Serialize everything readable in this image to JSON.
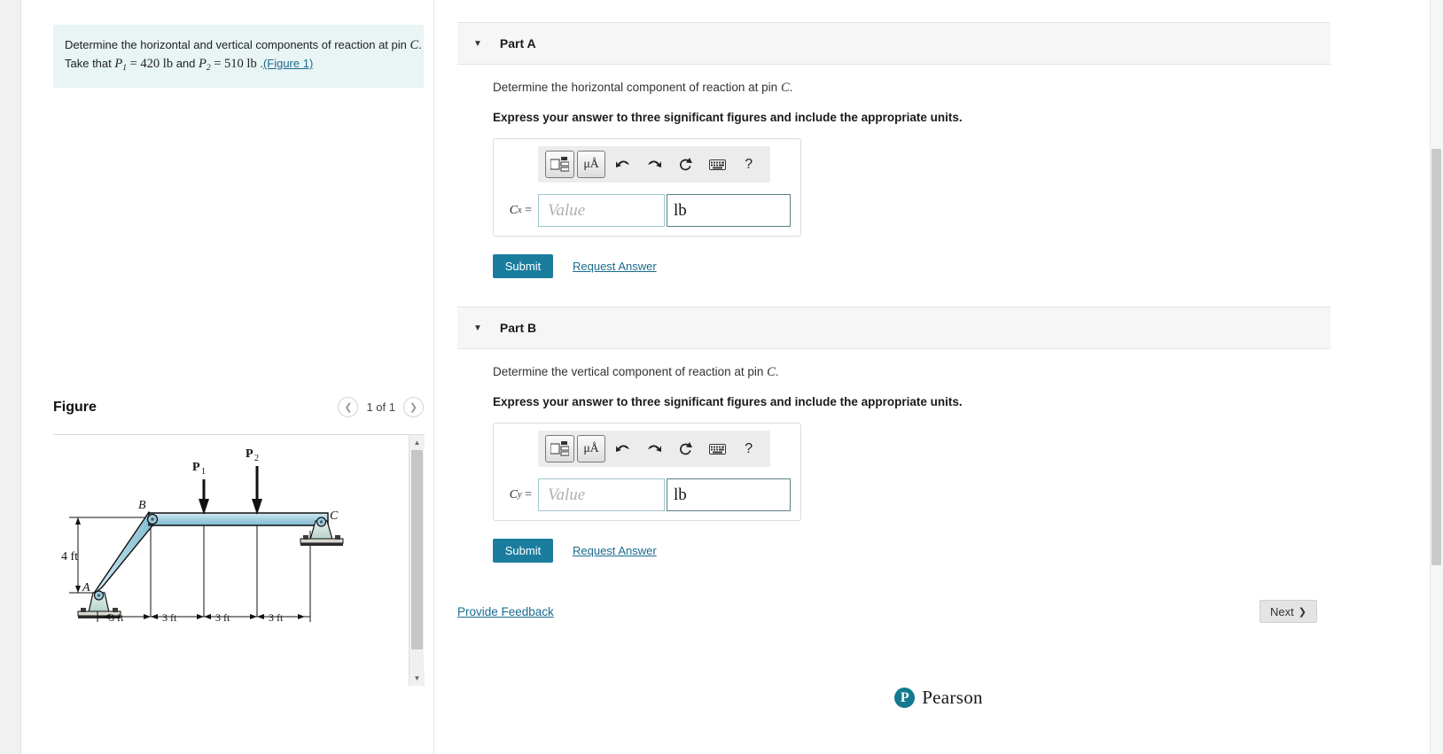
{
  "problem": {
    "line1_pre": "Determine the horizontal and vertical components of reaction at pin ",
    "line1_var": "C",
    "line1_post": ".",
    "line2_pre": "Take that ",
    "p1_name": "P",
    "p1_sub": "1",
    "p1_eq": " = 420 ",
    "p1_unit": "lb",
    "line2_mid": " and ",
    "p2_name": "P",
    "p2_sub": "2",
    "p2_eq": " = 510 ",
    "p2_unit": "lb",
    "line2_dot": " .",
    "figure_link": "(Figure 1)"
  },
  "figure": {
    "title": "Figure",
    "counter": "1 of 1",
    "prev_icon": "chevron-left-icon",
    "next_icon": "chevron-right-icon",
    "labels": {
      "point_a": "A",
      "point_b": "B",
      "point_c": "C",
      "force1": "P",
      "force1_sub": "1",
      "force2": "P",
      "force2_sub": "2",
      "height": "4 ft",
      "span1": "3 ft",
      "span2": "3 ft",
      "span3": "3 ft",
      "span4": "3 ft"
    },
    "colors": {
      "member_fill": "#a9d3e2",
      "member_stroke": "#1a1a1a",
      "support_fill": "#c8ded8"
    }
  },
  "parts": [
    {
      "id": "part-a",
      "label": "Part A",
      "caret_icon": "caret-down-icon",
      "question": "Determine the horizontal component of reaction at pin ",
      "question_var": "C",
      "question_post": ".",
      "instruction": "Express your answer to three significant figures and include the appropriate units.",
      "variable": "C",
      "variable_sub": "x",
      "value_placeholder": "Value",
      "unit_value": "lb",
      "submit_label": "Submit",
      "request_label": "Request Answer"
    },
    {
      "id": "part-b",
      "label": "Part B",
      "caret_icon": "caret-down-icon",
      "question": "Determine the vertical component of reaction at pin ",
      "question_var": "C",
      "question_post": ".",
      "instruction": "Express your answer to three significant figures and include the appropriate units.",
      "variable": "C",
      "variable_sub": "y",
      "value_placeholder": "Value",
      "unit_value": "lb",
      "submit_label": "Submit",
      "request_label": "Request Answer"
    }
  ],
  "toolbar": {
    "template_icon": "math-template-icon",
    "units_icon": "units-icon",
    "units_label": "μÅ",
    "undo_icon": "undo-icon",
    "redo_icon": "redo-icon",
    "reset_icon": "reset-icon",
    "keyboard_icon": "keyboard-icon",
    "help_icon": "help-icon",
    "help_label": "?"
  },
  "footer": {
    "feedback_label": "Provide Feedback",
    "next_label": "Next",
    "next_icon": "chevron-right-icon",
    "brand_mark": "P",
    "brand_name": "Pearson"
  },
  "colors": {
    "accent": "#1a7d9e",
    "link": "#1a6b8f",
    "prompt_bg": "#e9f4f4",
    "part_header_bg": "#f6f6f6"
  }
}
